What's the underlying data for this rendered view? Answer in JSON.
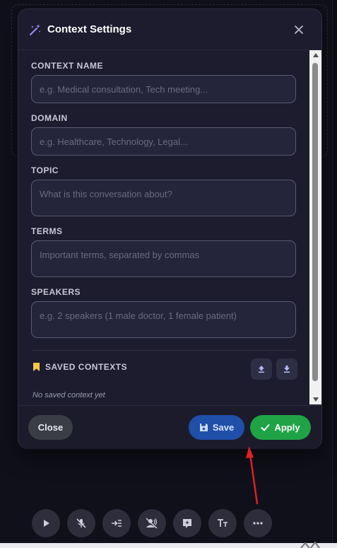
{
  "modal": {
    "title": "Context Settings",
    "fields": [
      {
        "label": "CONTEXT NAME",
        "placeholder": "e.g. Medical consultation, Tech meeting..."
      },
      {
        "label": "DOMAIN",
        "placeholder": "e.g. Healthcare, Technology, Legal..."
      },
      {
        "label": "TOPIC",
        "placeholder": "What is this conversation about?"
      },
      {
        "label": "TERMS",
        "placeholder": "Important terms, separated by commas"
      },
      {
        "label": "SPEAKERS",
        "placeholder": "e.g. 2 speakers (1 male doctor, 1 female patient)"
      }
    ],
    "saved": {
      "title": "SAVED CONTEXTS",
      "empty_text": "No saved context yet",
      "icons": [
        "bookmark-icon",
        "upload-icon",
        "download-icon"
      ]
    },
    "footer": {
      "close_label": "Close",
      "save_label": "Save",
      "apply_label": "Apply"
    }
  },
  "toolbar": {
    "icons": [
      "play-icon",
      "mic-off-icon",
      "indent-icon",
      "voice-off-icon",
      "ai-sparkle-icon",
      "text-size-icon",
      "more-icon"
    ]
  },
  "colors": {
    "modal_bg": "#1c1c2e",
    "save_button": "#1f4fa8",
    "apply_button": "#1fa346",
    "annotation_arrow": "#e02020",
    "bookmark": "#f5c842"
  }
}
